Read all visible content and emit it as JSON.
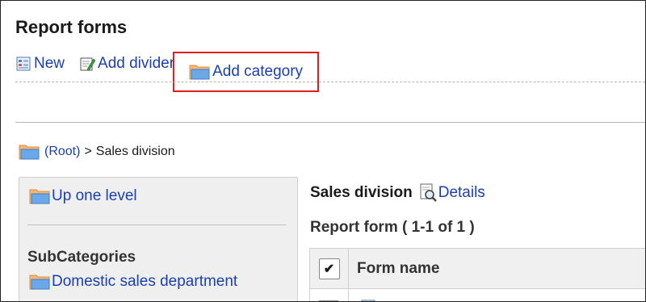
{
  "page": {
    "title": "Report forms"
  },
  "toolbar": {
    "new_label": "New",
    "add_divider_label": "Add divider",
    "add_category_label": "Add category"
  },
  "breadcrumb": {
    "root_label": "(Root)",
    "separator": ">",
    "current_label": "Sales division"
  },
  "sidebar": {
    "up_label": "Up one level",
    "heading": "SubCategories",
    "items": [
      {
        "label": "Domestic sales department"
      }
    ]
  },
  "main": {
    "title": "Sales division",
    "details_label": "Details",
    "count_text": "Report form ( 1-1 of 1 )",
    "table": {
      "check_symbol": "✔",
      "columns": [
        "Form name"
      ]
    }
  },
  "colors": {
    "link": "#1a3fb3",
    "highlight": "#e11d1d",
    "folder_fill": "#f6b775",
    "folder_tab": "#e08e3c",
    "folder_front": "#6aa8e8"
  }
}
